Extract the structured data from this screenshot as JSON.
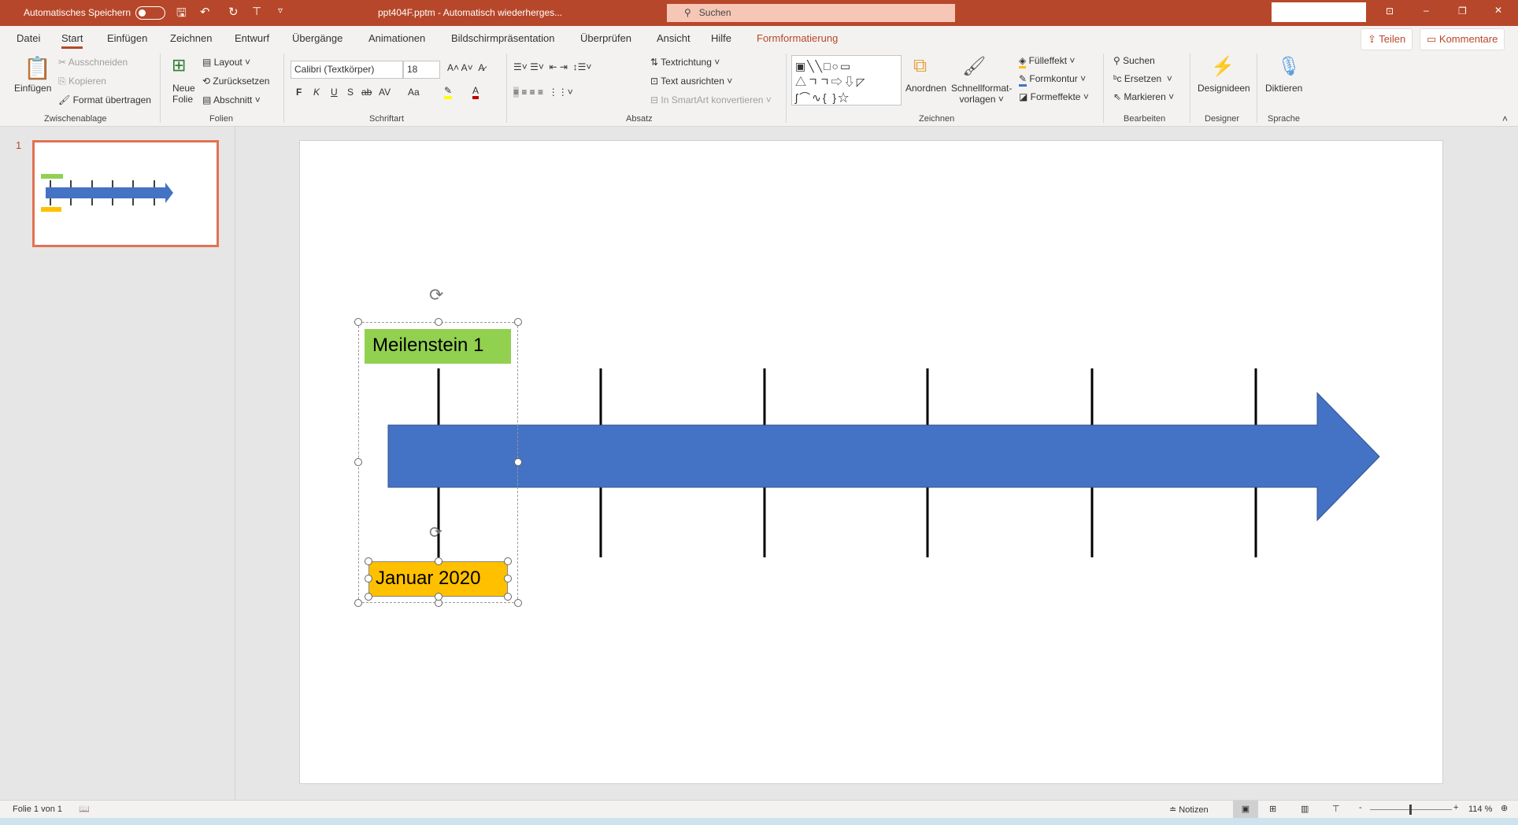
{
  "titlebar": {
    "autosave": "Automatisches Speichern",
    "title": "ppt404F.pptm  -  Automatisch wiederherges...",
    "search": "Suchen"
  },
  "tabs": [
    "Datei",
    "Start",
    "Einfügen",
    "Zeichnen",
    "Entwurf",
    "Übergänge",
    "Animationen",
    "Bildschirmpräsentation",
    "Überprüfen",
    "Ansicht",
    "Hilfe",
    "Formformatierung"
  ],
  "share": "Teilen",
  "comments": "Kommentare",
  "ribbon": {
    "clipboard": {
      "paste": "Einfügen",
      "cut": "Ausschneiden",
      "copy": "Kopieren",
      "format": "Format übertragen",
      "label": "Zwischenablage"
    },
    "slides": {
      "new1": "Neue",
      "new2": "Folie",
      "layout": "Layout",
      "reset": "Zurücksetzen",
      "section": "Abschnitt",
      "label": "Folien"
    },
    "font": {
      "name": "Calibri (Textkörper)",
      "size": "18",
      "bold": "F",
      "italic": "K",
      "underline": "U",
      "shadow": "S",
      "strike": "ab",
      "spacing": "AV",
      "case": "Aa",
      "label": "Schriftart"
    },
    "paragraph": {
      "direction": "Textrichtung",
      "align": "Text ausrichten",
      "smartart": "In SmartArt konvertieren",
      "label": "Absatz"
    },
    "drawing": {
      "arrange": "Anordnen",
      "quick1": "Schnellformat-",
      "quick2": "vorlagen",
      "fill": "Fülleffekt",
      "outline": "Formkontur",
      "effects": "Formeffekte",
      "label": "Zeichnen"
    },
    "editing": {
      "find": "Suchen",
      "replace": "Ersetzen",
      "select": "Markieren",
      "label": "Bearbeiten"
    },
    "designer": {
      "ideas": "Designideen",
      "label": "Designer"
    },
    "voice": {
      "dictate": "Diktieren",
      "label": "Sprache"
    }
  },
  "thumbnail": {
    "number": "1"
  },
  "slide": {
    "milestone": "Meilenstein 1",
    "date": "Januar 2020",
    "colors": {
      "arrow": "#4472c4",
      "milestone": "#92d050",
      "date": "#ffc000"
    }
  },
  "status": {
    "slide": "Folie 1 von 1",
    "notes": "Notizen",
    "zoom": "114 %"
  }
}
